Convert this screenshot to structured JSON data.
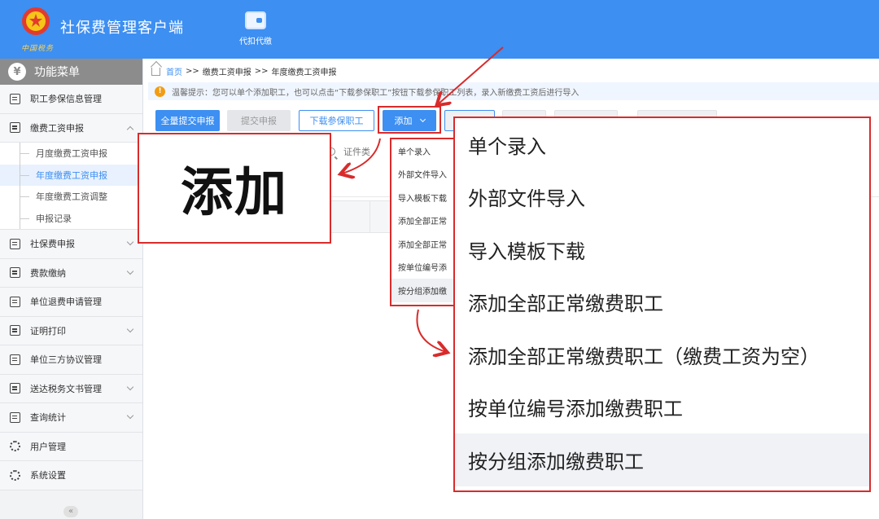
{
  "header": {
    "app_title": "社保费管理客户端",
    "emblem_caption": "中国税务",
    "nav_item": "代扣代缴"
  },
  "sidebar": {
    "menu_title": "功能菜单",
    "items": [
      {
        "label": "职工参保信息管理"
      },
      {
        "label": "缴费工资申报",
        "expanded": true,
        "children": [
          "月度缴费工资申报",
          "年度缴费工资申报",
          "年度缴费工资调整",
          "申报记录"
        ]
      },
      {
        "label": "社保费申报"
      },
      {
        "label": "费款缴纳"
      },
      {
        "label": "单位退费申请管理"
      },
      {
        "label": "证明打印"
      },
      {
        "label": "单位三方协议管理"
      },
      {
        "label": "送达税务文书管理"
      },
      {
        "label": "查询统计"
      },
      {
        "label": "用户管理"
      },
      {
        "label": "系统设置"
      }
    ],
    "active_child": "年度缴费工资申报",
    "collapse_glyph": "«"
  },
  "breadcrumb": {
    "home": "首页",
    "sep": ">>",
    "level1": "缴费工资申报",
    "level2": "年度缴费工资申报"
  },
  "tip": {
    "icon": "!",
    "text": "温馨提示：您可以单个添加职工，也可以点击“下载参保职工”按钮下载参保职工列表，录入新缴费工资后进行导入"
  },
  "toolbar": {
    "submit_all": "全量提交申报",
    "submit": "提交申报",
    "download": "下载参保职工",
    "add": "添加"
  },
  "search": {
    "label": "证件类"
  },
  "callout": {
    "text": "添加"
  },
  "add_menu": {
    "options": [
      "单个录入",
      "外部文件导入",
      "导入模板下载",
      "添加全部正常缴费职工",
      "添加全部正常缴费职工（缴费工资为空）",
      "按单位编号添加缴费职工",
      "按分组添加缴费职工"
    ],
    "small_options": [
      "单个录入",
      "外部文件导入",
      "导入模板下载",
      "添加全部正常",
      "添加全部正常",
      "按单位编号添",
      "按分组添加缴"
    ],
    "hovered_index": 6
  },
  "colors": {
    "brand_blue": "#3d8ff2",
    "highlight_red": "#d92b2b"
  }
}
